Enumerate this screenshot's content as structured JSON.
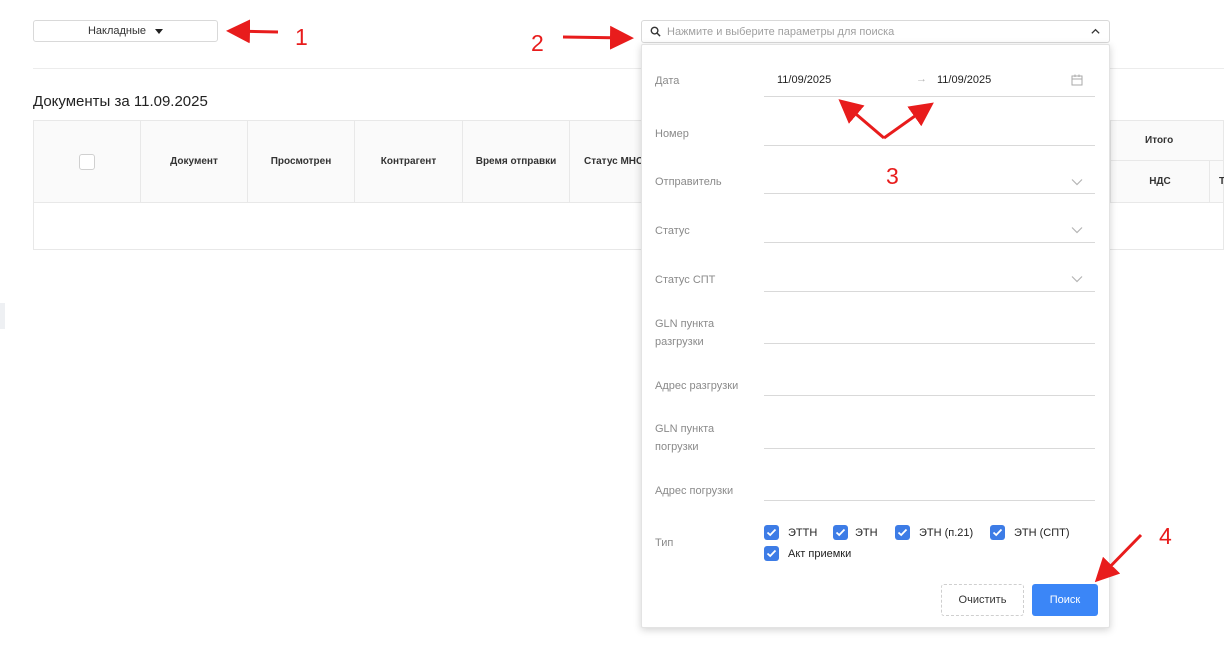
{
  "doc_type_select": {
    "label": "Накладные"
  },
  "page_heading": "Документы за 11.09.2025",
  "table": {
    "columns": [
      "Документ",
      "Просмотрен",
      "Контрагент",
      "Время отправки",
      "Статус МНС/"
    ],
    "group_header": "Итого",
    "sub_columns": [
      "НДС",
      "Т"
    ]
  },
  "search": {
    "placeholder": "Нажмите и выберите параметры для поиска"
  },
  "filter": {
    "date_label": "Дата",
    "date_from": "11/09/2025",
    "date_to": "11/09/2025",
    "date_arrow": "→",
    "number_label": "Номер",
    "sender_label": "Отправитель",
    "status_label": "Статус",
    "spt_status_label": "Статус СПТ",
    "gln_unload_label_1": "GLN пункта",
    "gln_unload_label_2": "разгрузки",
    "unload_address_label": "Адрес разгрузки",
    "gln_load_label_1": "GLN пункта",
    "gln_load_label_2": "погрузки",
    "load_address_label": "Адрес погрузки",
    "type_label": "Тип",
    "types": [
      "ЭТТН",
      "ЭТН",
      "ЭТН (п.21)",
      "ЭТН (СПТ)",
      "Акт приемки"
    ],
    "clear_button": "Очистить",
    "search_button": "Поиск"
  },
  "annotations": [
    "1",
    "2",
    "3",
    "4"
  ],
  "colors": {
    "accent": "#3b86f7",
    "checkbox": "#3d7ce6",
    "annotation": "#e81c1c"
  }
}
